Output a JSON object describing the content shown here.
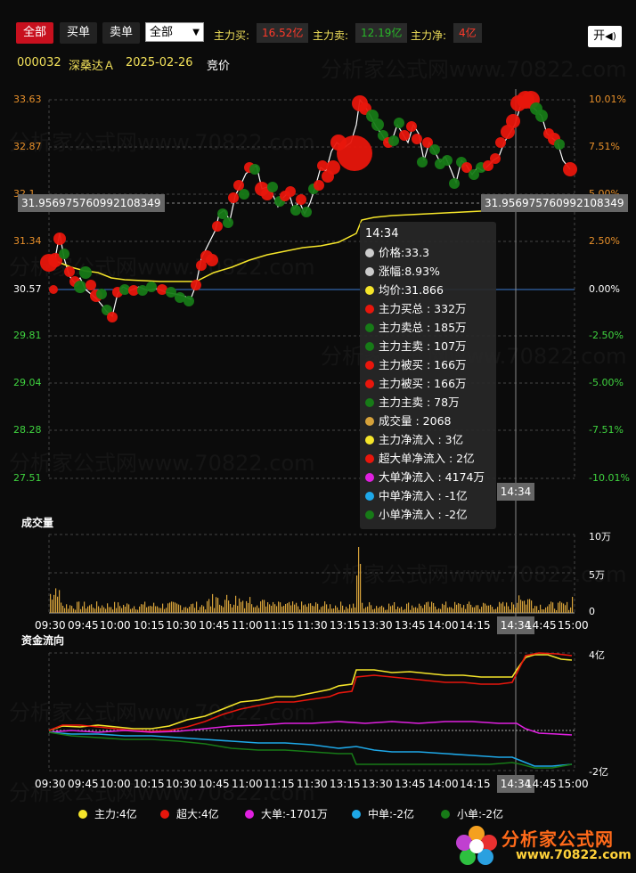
{
  "toolbar": {
    "filter_buttons": [
      {
        "label": "全部",
        "active": true
      },
      {
        "label": "买单",
        "active": false
      },
      {
        "label": "卖单",
        "active": false
      }
    ],
    "select_value": "全部",
    "main_buy_label": "主力买:",
    "main_buy_value": "16.52亿",
    "main_sell_label": "主力卖:",
    "main_sell_value": "12.19亿",
    "main_net_label": "主力净:",
    "main_net_value": "4亿",
    "sound_label": "开"
  },
  "stock": {
    "code": "000032",
    "name": "深桑达Ａ",
    "date": "2025-02-26",
    "mode": "竞价"
  },
  "price_axis": {
    "left_ticks": [
      "33.63",
      "32.87",
      "32.1",
      "31.34",
      "30.57",
      "29.81",
      "29.04",
      "28.28",
      "27.51"
    ],
    "right_ticks": [
      "10.01%",
      "7.51%",
      "5.00%",
      "2.50%",
      "0.00%",
      "-2.50%",
      "-5.00%",
      "-7.51%",
      "-10.01%"
    ]
  },
  "crosshair": {
    "price_label": "31.956975760992108349",
    "time_label": "14:34"
  },
  "tooltip": {
    "time": "14:34",
    "rows": [
      {
        "text": "价格:33.3",
        "color": "#cccccc"
      },
      {
        "text": "涨幅:8.93%",
        "color": "#cccccc"
      },
      {
        "text": "均价:31.866",
        "color": "#f5e52a"
      },
      {
        "text": "主力买总 : 332万",
        "color": "#e8160c"
      },
      {
        "text": "主力卖总 : 185万",
        "color": "#177a17"
      },
      {
        "text": "主力主卖 : 107万",
        "color": "#177a17"
      },
      {
        "text": "主力被买 : 166万",
        "color": "#e8160c"
      },
      {
        "text": "主力被买 : 166万",
        "color": "#e8160c"
      },
      {
        "text": "主力主卖 : 78万",
        "color": "#177a17"
      },
      {
        "text": "成交量 : 2068",
        "color": "#d6a23a"
      },
      {
        "text": "主力净流入 : 3亿",
        "color": "#f5e52a"
      },
      {
        "text": "超大单净流入 : 2亿",
        "color": "#e8160c"
      },
      {
        "text": "大单净流入 : 4174万",
        "color": "#e020e0"
      },
      {
        "text": "中单净流入 : -1亿",
        "color": "#1ea8e8"
      },
      {
        "text": "小单净流入 : -2亿",
        "color": "#177a17"
      }
    ]
  },
  "volume": {
    "title": "成交量",
    "axis_ticks": [
      "10万",
      "5万",
      "0"
    ]
  },
  "flow": {
    "title": "资金流向",
    "axis_top": "4亿",
    "axis_bottom": "-2亿"
  },
  "time_axis": [
    "09:30",
    "09:45",
    "10:00",
    "10:15",
    "10:30",
    "10:45",
    "11:00",
    "11:15",
    "11:30",
    "13:15",
    "13:30",
    "13:45",
    "14:00",
    "14:15",
    "14:34",
    "14:45",
    "15:00"
  ],
  "legend": [
    {
      "label": "主力:4亿",
      "color": "#f5e52a"
    },
    {
      "label": "超大:4亿",
      "color": "#e8160c"
    },
    {
      "label": "大单:-1701万",
      "color": "#e020e0"
    },
    {
      "label": "中单:-2亿",
      "color": "#1ea8e8"
    },
    {
      "label": "小单:-2亿",
      "color": "#177a17"
    }
  ],
  "logo": {
    "text": "分析家公式网",
    "url_text": "www.70822.com"
  },
  "watermark": "分析家公式网www.70822.com",
  "colors": {
    "buy": "#e8160c",
    "sell": "#177a17",
    "active_button": "#c8101e",
    "axis_orange": "#e8902a",
    "axis_green": "#3fd23f",
    "header_label": "#f2e15a"
  }
}
